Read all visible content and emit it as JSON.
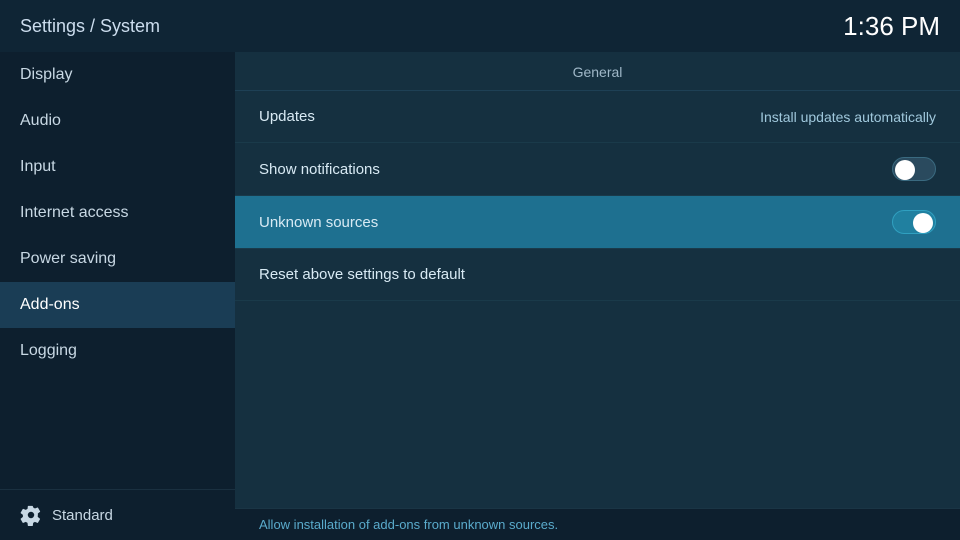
{
  "header": {
    "title": "Settings / System",
    "time": "1:36 PM"
  },
  "sidebar": {
    "items": [
      {
        "id": "display",
        "label": "Display",
        "active": false
      },
      {
        "id": "audio",
        "label": "Audio",
        "active": false
      },
      {
        "id": "input",
        "label": "Input",
        "active": false
      },
      {
        "id": "internet-access",
        "label": "Internet access",
        "active": false
      },
      {
        "id": "power-saving",
        "label": "Power saving",
        "active": false
      },
      {
        "id": "add-ons",
        "label": "Add-ons",
        "active": true
      },
      {
        "id": "logging",
        "label": "Logging",
        "active": false
      }
    ],
    "footer_label": "Standard"
  },
  "content": {
    "section_title": "General",
    "settings": [
      {
        "id": "updates",
        "label": "Updates",
        "value": "Install updates automatically",
        "toggle": null,
        "highlighted": false
      },
      {
        "id": "show-notifications",
        "label": "Show notifications",
        "value": null,
        "toggle": "off",
        "highlighted": false
      },
      {
        "id": "unknown-sources",
        "label": "Unknown sources",
        "value": null,
        "toggle": "on",
        "highlighted": true
      },
      {
        "id": "reset-settings",
        "label": "Reset above settings to default",
        "value": null,
        "toggle": null,
        "highlighted": false
      }
    ]
  },
  "footer": {
    "text": "Allow installation of add-ons from unknown sources."
  }
}
